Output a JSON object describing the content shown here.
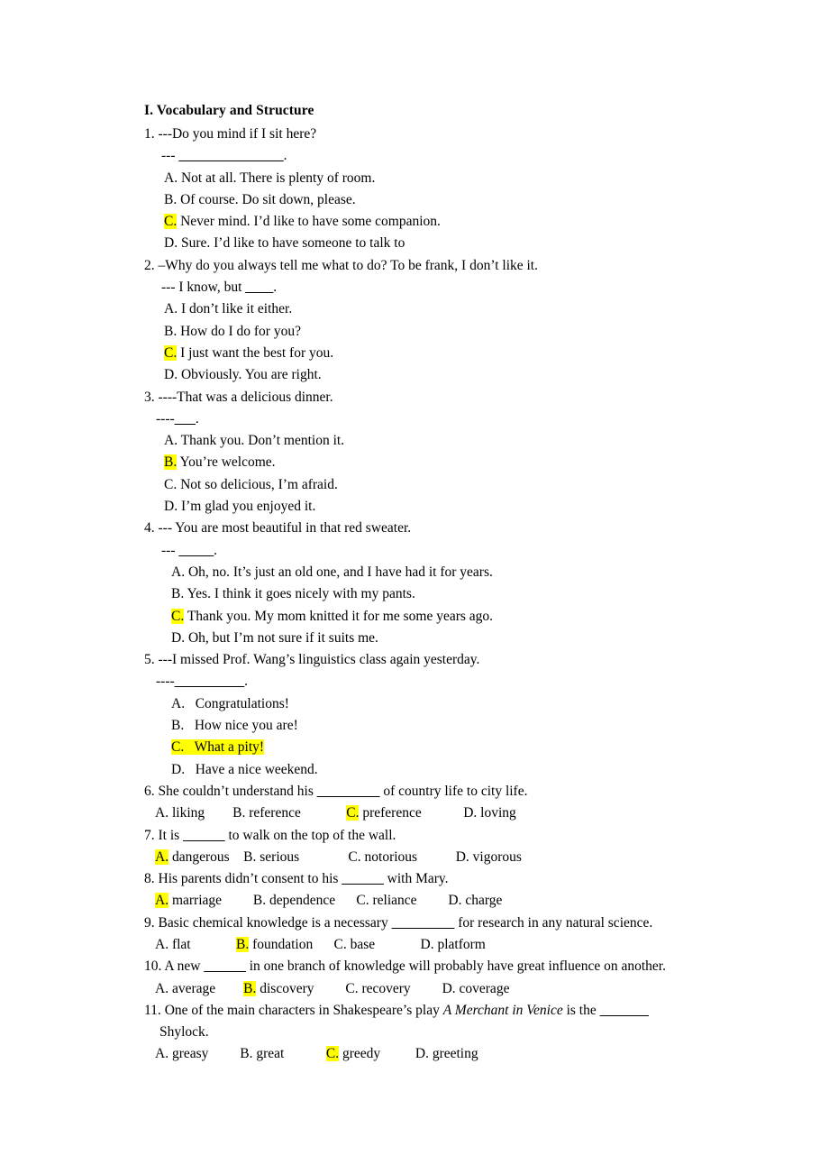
{
  "document": {
    "section_heading": "I. Vocabulary and Structure",
    "highlight_color": "#ffff00",
    "text_color": "#000000",
    "background_color": "#ffffff"
  },
  "questions": [
    {
      "number": "1.",
      "stem": "---Do you mind if I sit here?",
      "sub_prompt_prefix": "--- ",
      "sub_prompt_blank": "_______________",
      "sub_prompt_suffix": ".",
      "layout": "stacked",
      "options": [
        {
          "letter": "A.",
          "text": " Not at all. There is plenty of room.",
          "highlighted": false
        },
        {
          "letter": "B.",
          "text": " Of course. Do sit down, please.",
          "highlighted": false
        },
        {
          "letter": "C.",
          "text": " Never mind. I’d like to have some companion.",
          "highlighted": true
        },
        {
          "letter": "D.",
          "text": " Sure. I’d like to have someone to talk to",
          "highlighted": false
        }
      ]
    },
    {
      "number": "2.",
      "stem": "–Why do you always tell me what to do? To be frank, I don’t like it.",
      "sub_prompt_prefix": "--- I know, but ",
      "sub_prompt_blank": "____",
      "sub_prompt_suffix": ".",
      "layout": "stacked",
      "options": [
        {
          "letter": "A.",
          "text": " I don’t like it either.",
          "highlighted": false
        },
        {
          "letter": "B.",
          "text": " How do I do for you?",
          "highlighted": false
        },
        {
          "letter": "C.",
          "text": " I just want the best for you.",
          "highlighted": true
        },
        {
          "letter": "D.",
          "text": " Obviously. You are right.",
          "highlighted": false
        }
      ]
    },
    {
      "number": "3.",
      "stem": "----That was a delicious dinner.",
      "sub_prompt_prefix": "----",
      "sub_prompt_blank": "___",
      "sub_prompt_suffix": ".",
      "layout": "stacked",
      "options": [
        {
          "letter": "A.",
          "text": " Thank you. Don’t mention it.",
          "highlighted": false
        },
        {
          "letter": "B.",
          "text": " You’re welcome.",
          "highlighted": true
        },
        {
          "letter": "C.",
          "text": " Not so delicious, I’m afraid.",
          "highlighted": false
        },
        {
          "letter": "D.",
          "text": " I’m glad you enjoyed it.",
          "highlighted": false
        }
      ]
    },
    {
      "number": "4.",
      "stem": "--- You are most beautiful in that red sweater.",
      "sub_prompt_prefix": "--- ",
      "sub_prompt_blank": "_____",
      "sub_prompt_suffix": ".",
      "layout": "stacked-indented",
      "options": [
        {
          "letter": "A.",
          "text": " Oh, no. It’s just an old one, and I have had it for years.",
          "highlighted": false
        },
        {
          "letter": "B.",
          "text": " Yes. I think it goes nicely with my pants.",
          "highlighted": false
        },
        {
          "letter": "C.",
          "text": " Thank you. My mom knitted it for me some years ago.",
          "highlighted": true
        },
        {
          "letter": "D.",
          "text": " Oh, but I’m not sure if it suits me.",
          "highlighted": false
        }
      ]
    },
    {
      "number": "5.",
      "stem": "---I missed Prof. Wang’s linguistics class again yesterday.",
      "sub_prompt_prefix": "----",
      "sub_prompt_blank": "__________",
      "sub_prompt_suffix": ".",
      "layout": "stacked-indented-tab",
      "options": [
        {
          "letter": "A.",
          "text": "   Congratulations!",
          "highlighted": false,
          "highlight_whole": false
        },
        {
          "letter": "B.",
          "text": "   How nice you are!",
          "highlighted": false,
          "highlight_whole": false
        },
        {
          "letter": "C.",
          "text": "   What a pity!",
          "highlighted": true,
          "highlight_whole": true
        },
        {
          "letter": "D.",
          "text": "   Have a nice weekend.",
          "highlighted": false,
          "highlight_whole": false
        }
      ]
    },
    {
      "number": "6.",
      "stem_before": "She couldn’t understand his ",
      "stem_blank": "_________",
      "stem_after": " of country life to city life.",
      "layout": "inline",
      "options": [
        {
          "letter": "A.",
          "text": " liking",
          "highlighted": false,
          "gap": 8
        },
        {
          "letter": "B.",
          "text": " reference",
          "highlighted": false,
          "gap": 13
        },
        {
          "letter": "C.",
          "text": " preference",
          "highlighted": true,
          "gap": 12
        },
        {
          "letter": "D.",
          "text": " loving",
          "highlighted": false,
          "gap": 0
        }
      ]
    },
    {
      "number": "7.",
      "stem_before": "It is ",
      "stem_blank": "______",
      "stem_after": " to walk on the top of the wall.",
      "layout": "inline",
      "options": [
        {
          "letter": "A.",
          "text": " dangerous",
          "highlighted": true,
          "gap": 4
        },
        {
          "letter": "B.",
          "text": " serious",
          "highlighted": false,
          "gap": 14
        },
        {
          "letter": "C.",
          "text": " notorious",
          "highlighted": false,
          "gap": 11
        },
        {
          "letter": "D.",
          "text": " vigorous",
          "highlighted": false,
          "gap": 0
        }
      ]
    },
    {
      "number": "8.",
      "stem_before": "His parents didn’t consent to his ",
      "stem_blank": "______",
      "stem_after": " with Mary.",
      "layout": "inline",
      "options": [
        {
          "letter": "A.",
          "text": " marriage",
          "highlighted": true,
          "gap": 9
        },
        {
          "letter": "B.",
          "text": " dependence",
          "highlighted": false,
          "gap": 6
        },
        {
          "letter": "C.",
          "text": " reliance",
          "highlighted": false,
          "gap": 9
        },
        {
          "letter": "D.",
          "text": " charge",
          "highlighted": false,
          "gap": 0
        }
      ]
    },
    {
      "number": "9.",
      "stem_before": "Basic chemical knowledge is a necessary ",
      "stem_blank": "_________",
      "stem_after": " for research in any natural science.",
      "layout": "inline",
      "options": [
        {
          "letter": "A.",
          "text": " flat",
          "highlighted": false,
          "gap": 13
        },
        {
          "letter": "B.",
          "text": " foundation",
          "highlighted": true,
          "gap": 6
        },
        {
          "letter": "C.",
          "text": " base",
          "highlighted": false,
          "gap": 13
        },
        {
          "letter": "D.",
          "text": " platform",
          "highlighted": false,
          "gap": 0
        }
      ]
    },
    {
      "number": "10.",
      "stem_before": "A new ",
      "stem_blank": "______",
      "stem_after": " in one branch of knowledge will probably have great influence on another.",
      "layout": "inline",
      "options": [
        {
          "letter": "A.",
          "text": " average",
          "highlighted": false,
          "gap": 8
        },
        {
          "letter": "B.",
          "text": " discovery",
          "highlighted": true,
          "gap": 9
        },
        {
          "letter": "C.",
          "text": " recovery",
          "highlighted": false,
          "gap": 9
        },
        {
          "letter": "D.",
          "text": " coverage",
          "highlighted": false,
          "gap": 0
        }
      ]
    },
    {
      "number": "11.",
      "stem_part1": "One of the main characters in Shakespeare’s play ",
      "stem_italic": "A Merchant in Venice",
      "stem_part2": " is the ",
      "stem_blank": "_______",
      "stem_continuation": "Shylock.",
      "layout": "inline-justified",
      "options": [
        {
          "letter": "A.",
          "text": " greasy",
          "highlighted": false,
          "gap": 9
        },
        {
          "letter": "B.",
          "text": " great",
          "highlighted": false,
          "gap": 12
        },
        {
          "letter": "C.",
          "text": " greedy",
          "highlighted": true,
          "gap": 10
        },
        {
          "letter": "D.",
          "text": " greeting",
          "highlighted": false,
          "gap": 0
        }
      ]
    }
  ]
}
